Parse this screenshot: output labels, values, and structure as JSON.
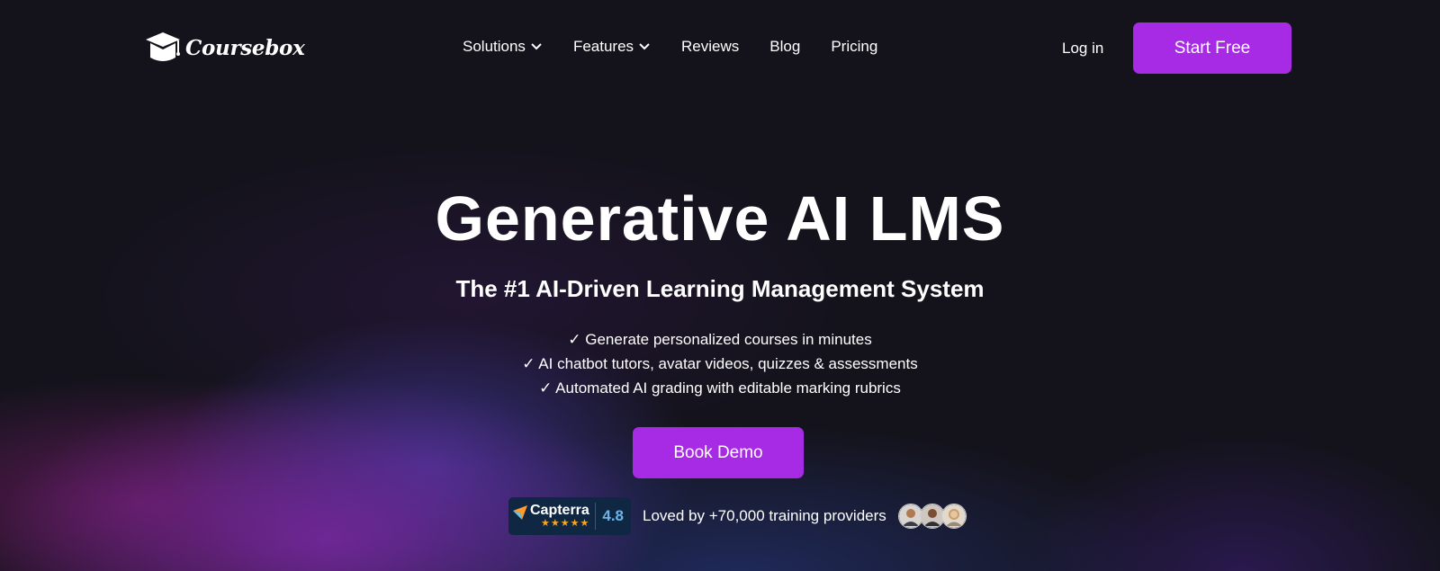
{
  "nav": {
    "brand": "Coursebox",
    "menu": [
      {
        "label": "Solutions",
        "has_dropdown": true
      },
      {
        "label": "Features",
        "has_dropdown": true
      },
      {
        "label": "Reviews",
        "has_dropdown": false
      },
      {
        "label": "Blog",
        "has_dropdown": false
      },
      {
        "label": "Pricing",
        "has_dropdown": false
      }
    ],
    "login_label": "Log in",
    "start_label": "Start Free"
  },
  "hero": {
    "title": "Generative AI LMS",
    "subtitle": "The #1 AI-Driven Learning Management System",
    "bullets": [
      "✓ Generate personalized courses in minutes",
      "✓ AI chatbot tutors, avatar videos, quizzes & assessments",
      "✓ Automated AI grading with editable marking rubrics"
    ],
    "cta_label": "Book Demo"
  },
  "social_proof": {
    "capterra_name": "Capterra",
    "capterra_rating": "4.8",
    "capterra_stars": 5,
    "loved_text": "Loved by +70,000 training providers",
    "avatar_count": 3
  },
  "colors": {
    "background": "#14131c",
    "accent": "#a72be4",
    "capterra_badge": "#0f2742",
    "star": "#f5a623",
    "rating": "#6bb5e8"
  },
  "icons": {
    "logo": "graduation-cap-icon",
    "dropdown": "chevron-down-icon",
    "capterra": "capterra-arrow-icon",
    "star": "star-icon"
  }
}
